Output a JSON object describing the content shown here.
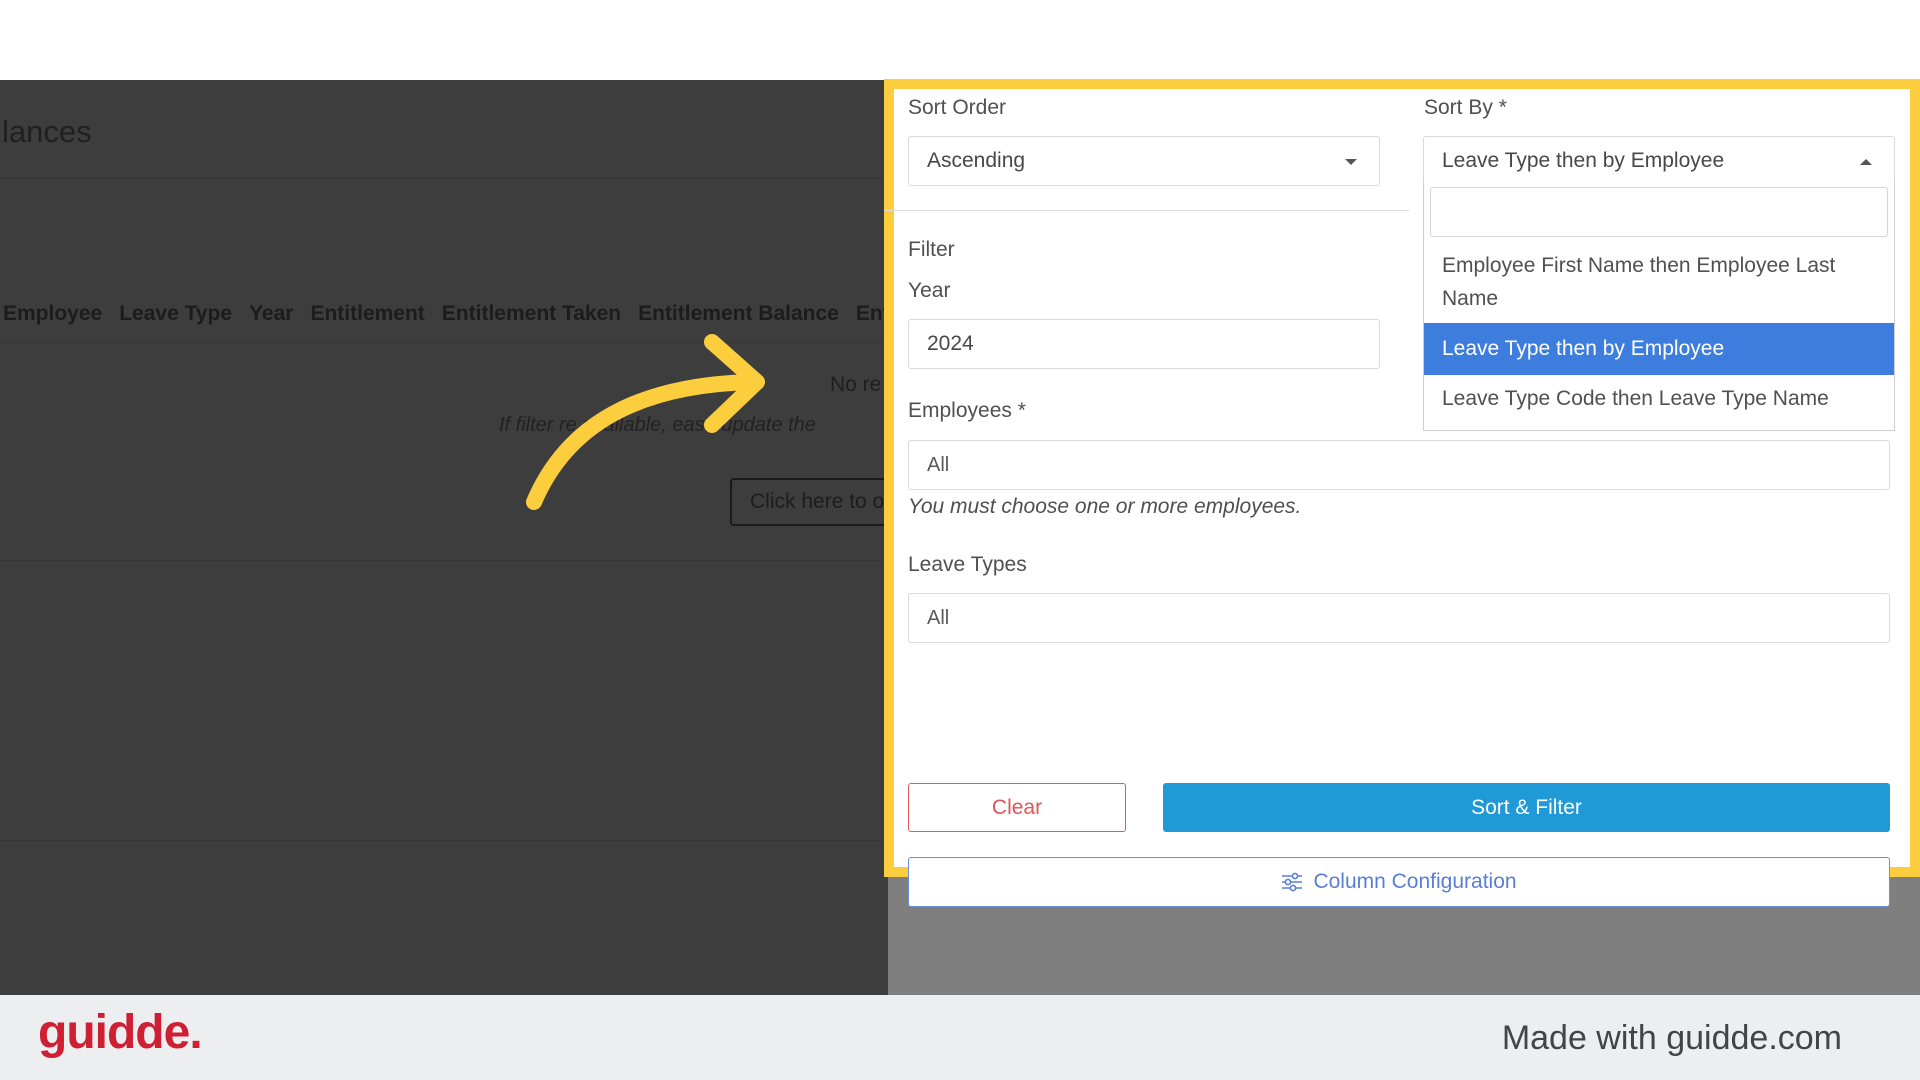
{
  "background": {
    "title": "lances",
    "table_headers": [
      "Employee",
      "Leave Type",
      "Year",
      "Entitlement",
      "Entitlement Taken",
      "Entitlement Balance",
      "Entitl"
    ],
    "no_results": "No re",
    "hint": "If filter   re available,   ease update the",
    "button": "Click here to o"
  },
  "form": {
    "sort_order_label": "Sort Order",
    "sort_order_value": "Ascending",
    "sort_by_label": "Sort By *",
    "sort_by_value": "Leave Type then by Employee",
    "sort_by_options": [
      "Employee First Name then Employee Last Name",
      "Leave Type then by Employee",
      "Leave Type Code then Leave Type Name"
    ],
    "filter_label": "Filter",
    "year_label": "Year",
    "year_value": "2024",
    "employees_label": "Employees *",
    "employees_placeholder": "All",
    "employees_hint": "You must choose one or more employees.",
    "leave_types_label": "Leave Types",
    "leave_types_placeholder": "All",
    "clear_label": "Clear",
    "sort_filter_label": "Sort & Filter",
    "column_config_label": "Column Configuration"
  },
  "footer": {
    "logo": "guidde.",
    "made_with": "Made with guidde.com"
  },
  "colors": {
    "highlight": "#fccd3c",
    "primary": "#1f9ad6",
    "selected_option": "#3d7ddd",
    "danger": "#e05555",
    "brand": "#cf1f33"
  }
}
